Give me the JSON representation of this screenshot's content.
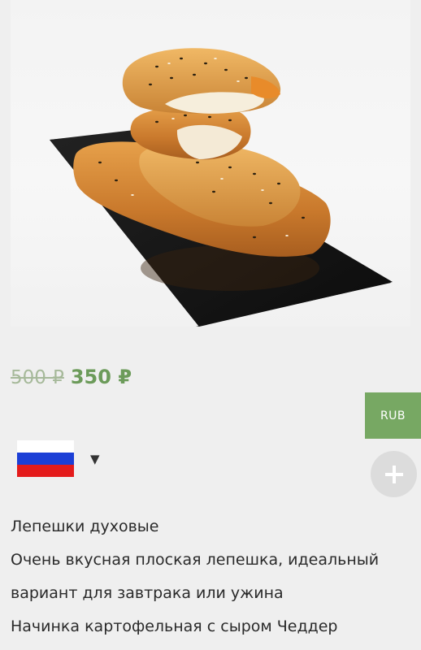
{
  "product": {
    "image_alt": "Лепешки духовые",
    "old_price": "500 ₽",
    "new_price": "350 ₽",
    "name": "Лепешки духовые",
    "description_line1": "Очень вкусная плоская лепешка, идеальный",
    "description_line2": "вариант для завтрака или ужина",
    "filling": "Начинка картофельная с сыром Чеддер"
  },
  "currency": {
    "label": "RUB"
  },
  "language": {
    "flag": "russia-flag",
    "caret": "▼"
  },
  "icons": {
    "add": "plus-icon"
  },
  "colors": {
    "accent": "#77a863",
    "price": "#6c9b5a",
    "old_price": "#a6b99a",
    "background": "#efefef"
  }
}
